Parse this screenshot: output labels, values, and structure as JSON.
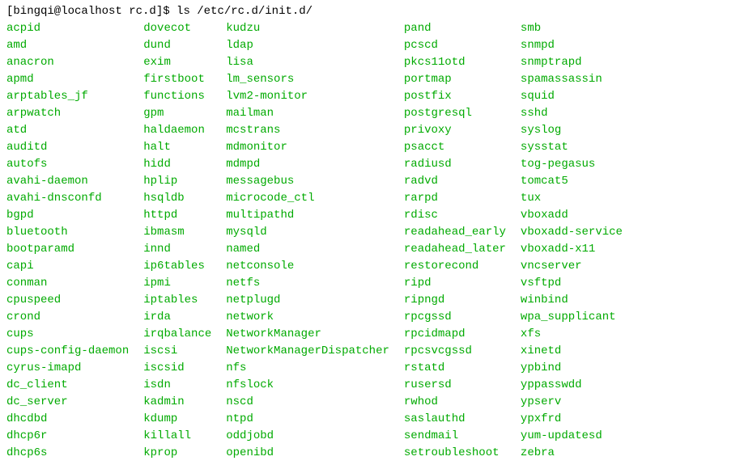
{
  "prompt": {
    "user_host": "[bingqi@localhost rc.d]$",
    "command": "ls /etc/rc.d/init.d/"
  },
  "columns": [
    [
      "acpid",
      "amd",
      "anacron",
      "apmd",
      "arptables_jf",
      "arpwatch",
      "atd",
      "auditd",
      "autofs",
      "avahi-daemon",
      "avahi-dnsconfd",
      "bgpd",
      "bluetooth",
      "bootparamd",
      "capi",
      "conman",
      "cpuspeed",
      "crond",
      "cups",
      "cups-config-daemon",
      "cyrus-imapd",
      "dc_client",
      "dc_server",
      "dhcdbd",
      "dhcp6r",
      "dhcp6s"
    ],
    [
      "dovecot",
      "dund",
      "exim",
      "firstboot",
      "functions",
      "gpm",
      "haldaemon",
      "halt",
      "hidd",
      "hplip",
      "hsqldb",
      "httpd",
      "ibmasm",
      "innd",
      "ip6tables",
      "ipmi",
      "iptables",
      "irda",
      "irqbalance",
      "iscsi",
      "iscsid",
      "isdn",
      "kadmin",
      "kdump",
      "killall",
      "kprop"
    ],
    [
      "kudzu",
      "ldap",
      "lisa",
      "lm_sensors",
      "lvm2-monitor",
      "mailman",
      "mcstrans",
      "mdmonitor",
      "mdmpd",
      "messagebus",
      "microcode_ctl",
      "multipathd",
      "mysqld",
      "named",
      "netconsole",
      "netfs",
      "netplugd",
      "network",
      "NetworkManager",
      "NetworkManagerDispatcher",
      "nfs",
      "nfslock",
      "nscd",
      "ntpd",
      "oddjobd",
      "openibd"
    ],
    [
      "pand",
      "pcscd",
      "pkcs11otd",
      "portmap",
      "postfix",
      "postgresql",
      "privoxy",
      "psacct",
      "radiusd",
      "radvd",
      "rarpd",
      "rdisc",
      "readahead_early",
      "readahead_later",
      "restorecond",
      "ripd",
      "ripngd",
      "rpcgssd",
      "rpcidmapd",
      "rpcsvcgssd",
      "rstatd",
      "rusersd",
      "rwhod",
      "saslauthd",
      "sendmail",
      "setroubleshoot"
    ],
    [
      "smb",
      "snmpd",
      "snmptrapd",
      "spamassassin",
      "squid",
      "sshd",
      "syslog",
      "sysstat",
      "tog-pegasus",
      "tomcat5",
      "tux",
      "vboxadd",
      "vboxadd-service",
      "vboxadd-x11",
      "vncserver",
      "vsftpd",
      "winbind",
      "wpa_supplicant",
      "xfs",
      "xinetd",
      "ypbind",
      "yppasswdd",
      "ypserv",
      "ypxfrd",
      "yum-updatesd",
      "zebra"
    ]
  ]
}
